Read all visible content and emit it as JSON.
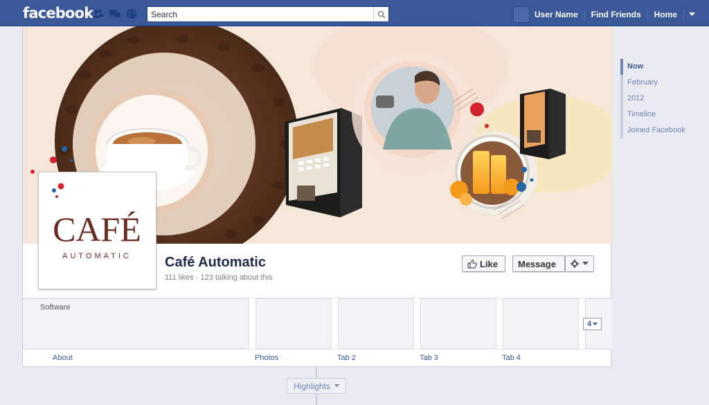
{
  "topbar": {
    "logo": "facebook",
    "search_placeholder": "Search",
    "user_name": "User Name",
    "find_friends": "Find Friends",
    "home": "Home"
  },
  "profile": {
    "logo_word": "CAFÉ",
    "logo_sub": "AUTOMATIC",
    "name": "Café Automatic",
    "stats": "111 likes · 123 talking about this"
  },
  "actions": {
    "like": "Like",
    "message": "Message"
  },
  "apps": {
    "about_text": "Software",
    "about_label": "About",
    "tabs": [
      "Photos",
      "Tab 2",
      "Tab 3",
      "Tab 4"
    ],
    "more_count": "4"
  },
  "highlights_label": "Highlights",
  "scrubber": [
    "Now",
    "February",
    "2012",
    "Timeline",
    "Joined Facebook"
  ],
  "colors": {
    "brand_blue": "#3b5998",
    "cover_bg": "#f4e6d8",
    "logo_brown": "#6b2a1e",
    "accent_red": "#d3222c",
    "accent_blue": "#2463a8"
  }
}
